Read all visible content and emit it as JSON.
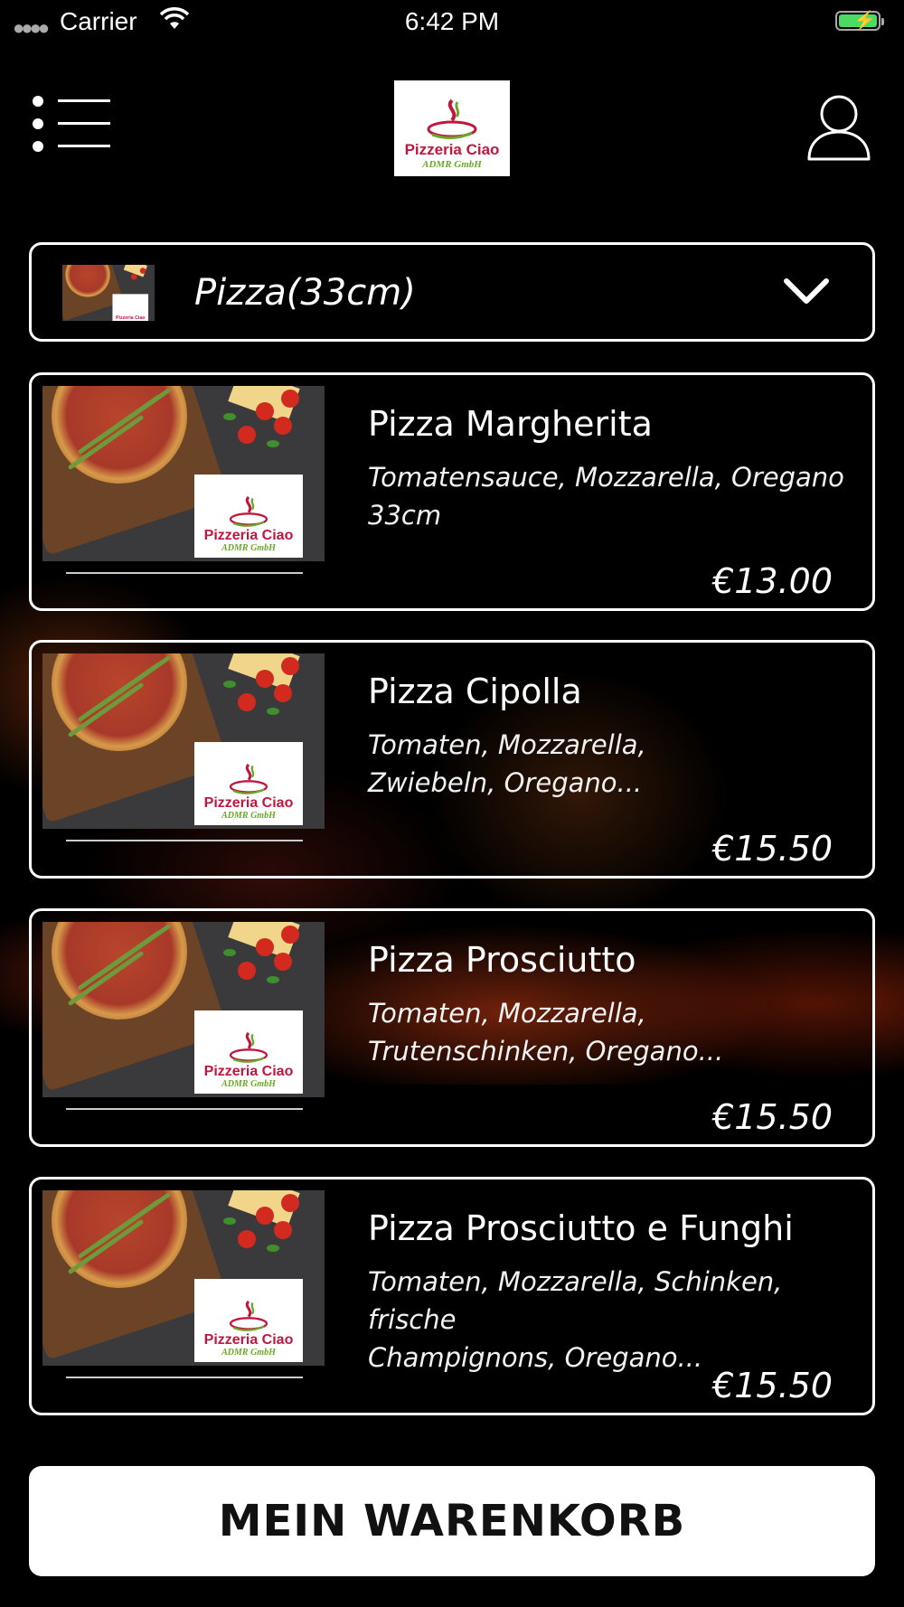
{
  "status_bar": {
    "carrier": "Carrier",
    "time": "6:42 PM"
  },
  "header": {
    "logo_name": "Pizzeria Ciao",
    "logo_sub": "ADMR GmbH"
  },
  "category": {
    "label": "Pizza(33cm)"
  },
  "products": [
    {
      "title": "Pizza Margherita",
      "desc_line1": "Tomatensauce, Mozzarella, Oregano",
      "desc_line2": "33cm",
      "price": "€13.00"
    },
    {
      "title": "Pizza Cipolla",
      "desc_line1": "Tomaten, Mozzarella,",
      "desc_line2": "Zwiebeln, Oregano...",
      "price": "€15.50"
    },
    {
      "title": "Pizza Prosciutto",
      "desc_line1": "Tomaten, Mozzarella,",
      "desc_line2": "Trutenschinken, Oregano...",
      "price": "€15.50"
    },
    {
      "title": "Pizza Prosciutto e Funghi",
      "desc_line1": "Tomaten, Mozzarella, Schinken, frische",
      "desc_line2": "Champignons, Oregano...",
      "price": "€15.50"
    }
  ],
  "cart_button": {
    "label": "MEIN WARENKORB"
  },
  "icons": {
    "menu": "menu-icon",
    "user": "user-icon",
    "dropdown": "chevron-down-icon",
    "wifi": "wifi-icon",
    "battery": "battery-charging-icon"
  },
  "colors": {
    "background": "#000000",
    "logo_red": "#c0173f",
    "logo_green": "#6aa829",
    "battery_green": "#4cd964"
  }
}
